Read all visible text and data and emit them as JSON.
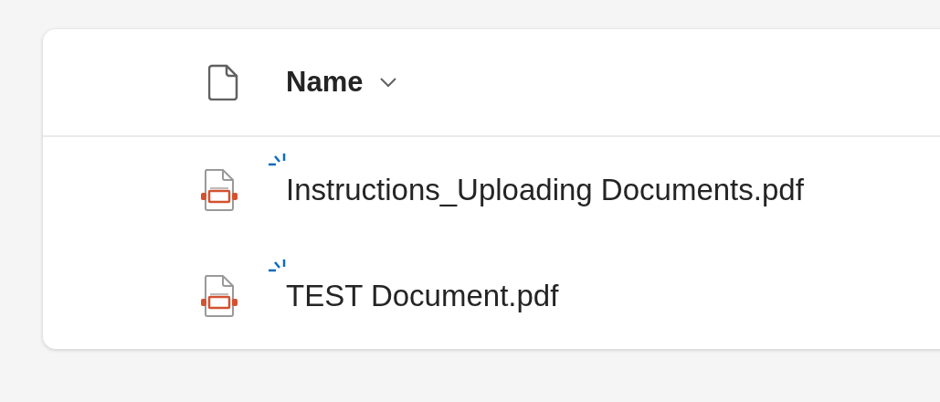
{
  "header": {
    "column_label": "Name"
  },
  "files": [
    {
      "name": "Instructions_Uploading Documents.pdf",
      "new": true
    },
    {
      "name": "TEST Document.pdf",
      "new": true
    }
  ]
}
